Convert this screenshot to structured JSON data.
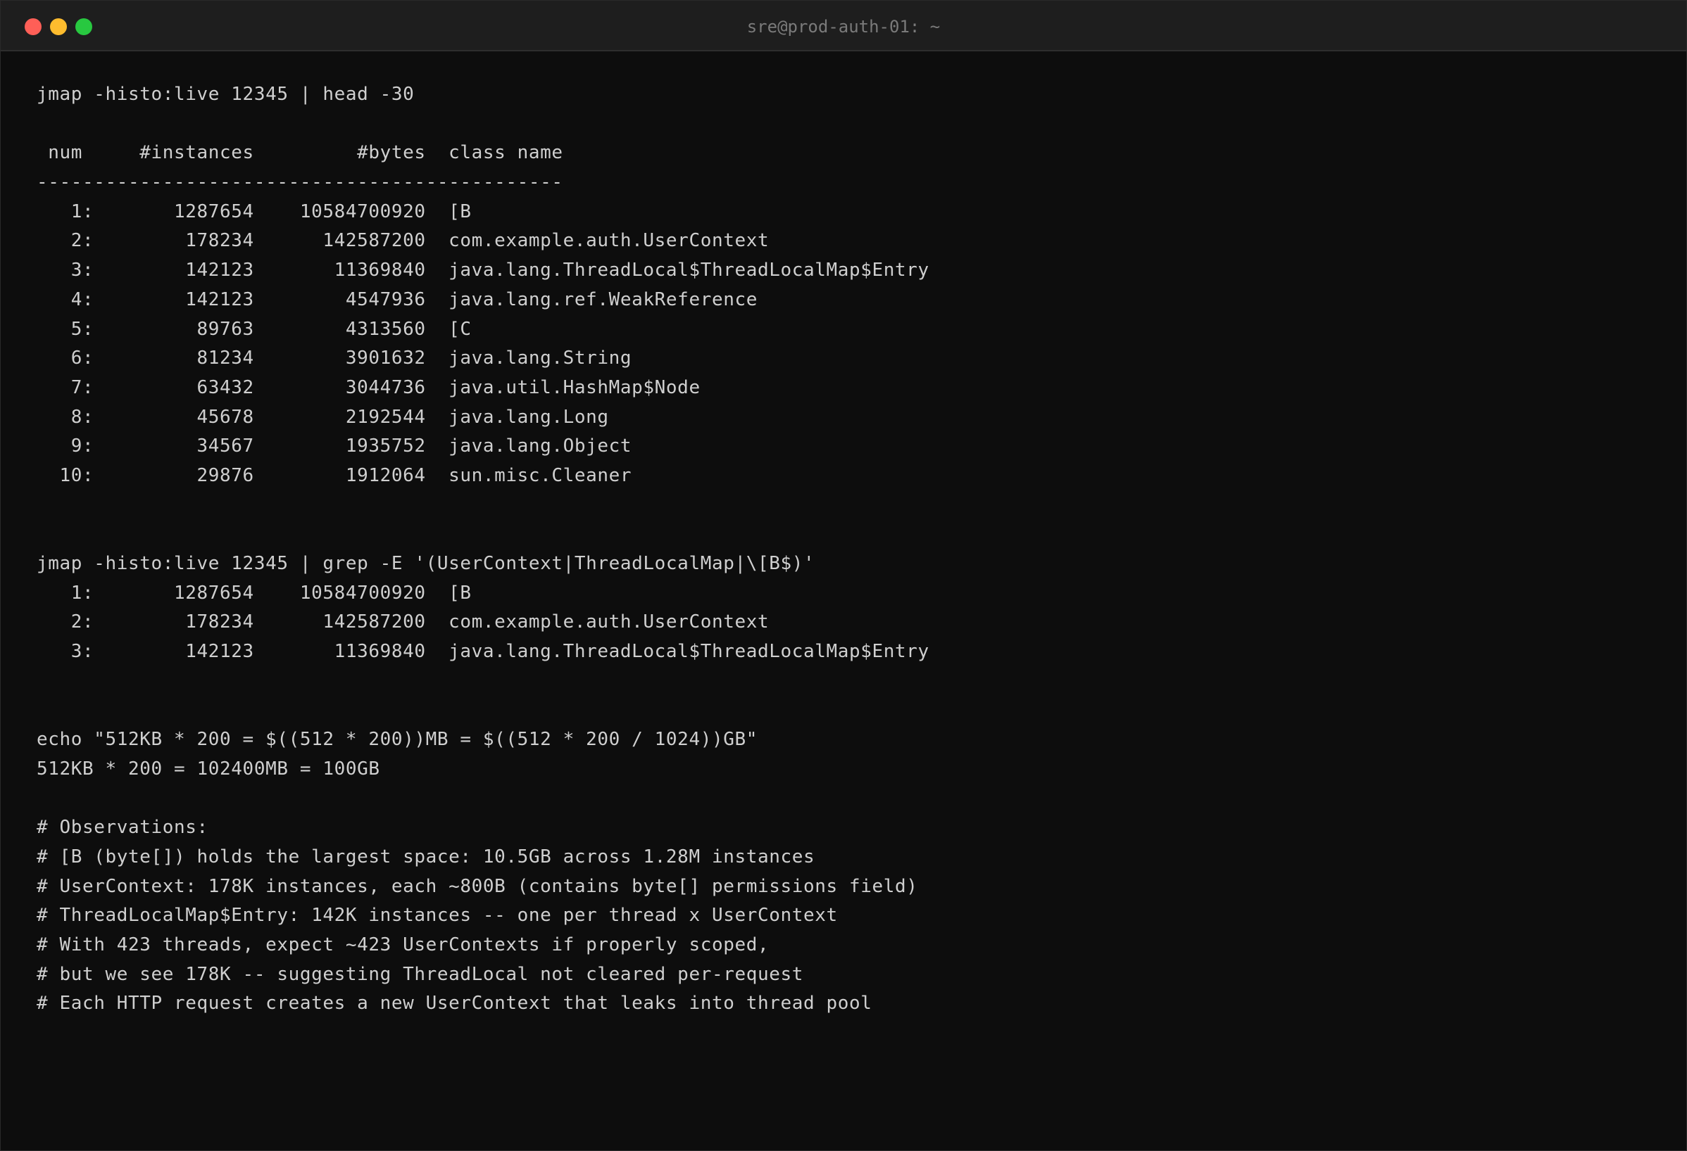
{
  "window": {
    "title": "sre@prod-auth-01: ~"
  },
  "terminal": {
    "lines": [
      "jmap -histo:live 12345 | head -30",
      "",
      " num     #instances         #bytes  class name",
      "----------------------------------------------",
      "   1:       1287654    10584700920  [B",
      "   2:        178234      142587200  com.example.auth.UserContext",
      "   3:        142123       11369840  java.lang.ThreadLocal$ThreadLocalMap$Entry",
      "   4:        142123        4547936  java.lang.ref.WeakReference",
      "   5:         89763        4313560  [C",
      "   6:         81234        3901632  java.lang.String",
      "   7:         63432        3044736  java.util.HashMap$Node",
      "   8:         45678        2192544  java.lang.Long",
      "   9:         34567        1935752  java.lang.Object",
      "  10:         29876        1912064  sun.misc.Cleaner",
      "",
      "",
      "jmap -histo:live 12345 | grep -E '(UserContext|ThreadLocalMap|\\[B$)'",
      "   1:       1287654    10584700920  [B",
      "   2:        178234      142587200  com.example.auth.UserContext",
      "   3:        142123       11369840  java.lang.ThreadLocal$ThreadLocalMap$Entry",
      "",
      "",
      "echo \"512KB * 200 = $((512 * 200))MB = $((512 * 200 / 1024))GB\"",
      "512KB * 200 = 102400MB = 100GB",
      "",
      "# Observations:",
      "# [B (byte[]) holds the largest space: 10.5GB across 1.28M instances",
      "# UserContext: 178K instances, each ~800B (contains byte[] permissions field)",
      "# ThreadLocalMap$Entry: 142K instances -- one per thread x UserContext",
      "# With 423 threads, expect ~423 UserContexts if properly scoped,",
      "# but we see 178K -- suggesting ThreadLocal not cleared per-request",
      "# Each HTTP request creates a new UserContext that leaks into thread pool"
    ]
  },
  "colors": {
    "background": "#0d0d0d",
    "titlebar": "#1e1e1e",
    "text": "#cfcfcf",
    "close": "#ff5f57",
    "minimize": "#febc2e",
    "maximize": "#28c840"
  }
}
